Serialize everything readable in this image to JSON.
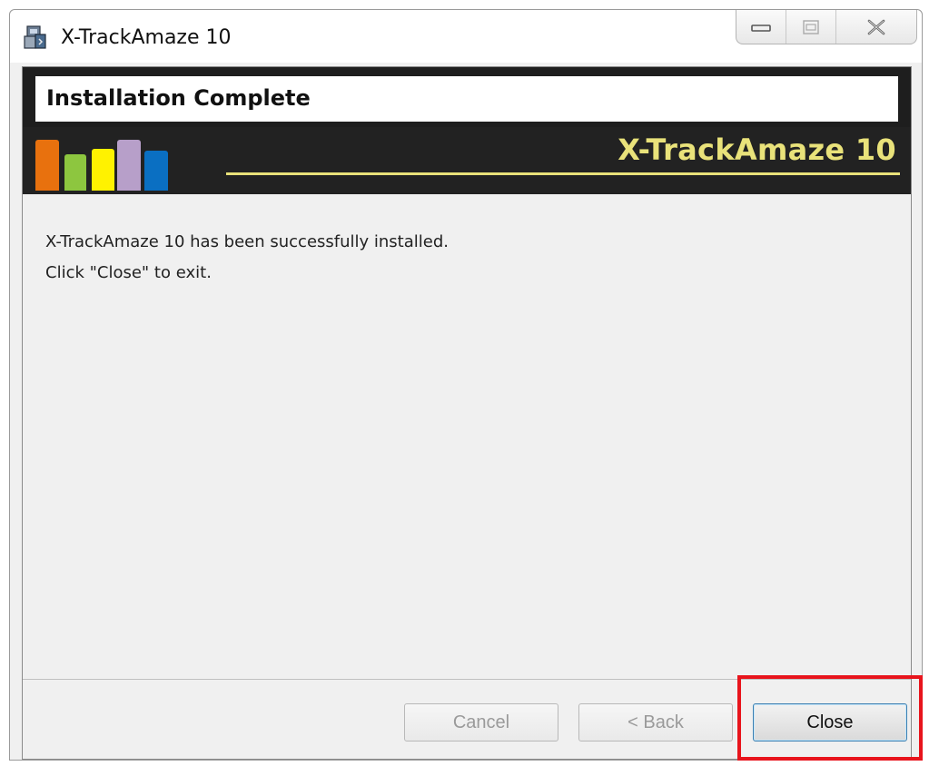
{
  "window": {
    "title": "X-TrackAmaze 10",
    "icon": "installer-icon"
  },
  "caption_buttons": {
    "minimize_icon": "minimize-icon",
    "maximize_icon": "maximize-icon",
    "close_icon": "close-icon"
  },
  "banner": {
    "title": "Installation Complete",
    "brand": "X-TrackAmaze 10",
    "bar_colors": [
      "#e8710e",
      "#8dc63f",
      "#fff200",
      "#b79fc9",
      "#0a6fc2"
    ],
    "accent_color": "#e9e27a"
  },
  "content": {
    "line1": "X-TrackAmaze 10 has been successfully installed.",
    "line2": "Click \"Close\" to exit."
  },
  "buttons": {
    "cancel": "Cancel",
    "back": "< Back",
    "close": "Close"
  },
  "annotation": {
    "highlight_color": "#e8141c"
  }
}
